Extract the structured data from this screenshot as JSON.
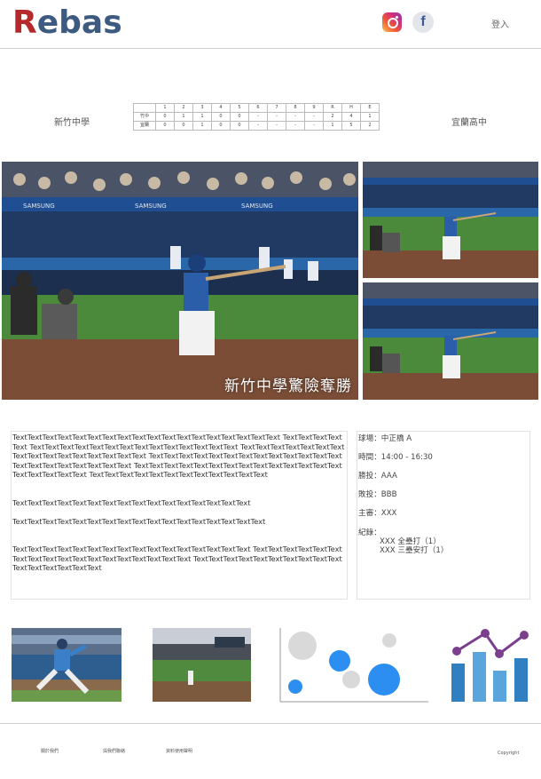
{
  "header": {
    "logo_first": "R",
    "logo_rest": "ebas",
    "login_label": "登入",
    "icons": [
      "instagram-icon",
      "facebook-icon"
    ],
    "facebook_glyph": "f"
  },
  "scoreboard": {
    "home_team": "新竹中學",
    "away_team": "宜蘭高中",
    "header": [
      "",
      "1",
      "2",
      "3",
      "4",
      "5",
      "6",
      "7",
      "8",
      "9",
      "R",
      "H",
      "E"
    ],
    "rows": [
      [
        "竹中",
        "0",
        "1",
        "1",
        "0",
        "0",
        "-",
        "-",
        "-",
        "-",
        "2",
        "4",
        "1"
      ],
      [
        "宜蘭",
        "0",
        "0",
        "1",
        "0",
        "0",
        "-",
        "-",
        "-",
        "-",
        "1",
        "5",
        "2"
      ]
    ]
  },
  "hero": {
    "caption": "新竹中學驚險奪勝",
    "banner_text": "SAMSUNG"
  },
  "article": {
    "paragraphs": [
      "TextTextTextTextTextTextTextTextTextTextTextTextTextTextTextTextTextText TextTextTextTextText TextTextTextTextTextTextTextTextTextTextTextTextTextText TextTextTextTextTextTextTextTextTextTextTextTextTextTextTextText TextTextTextTextTextTextTextTextTextTextTextTextTextTextTextTextTextTextTextTextText TextTextTextTextTextTextTextTextTextTextTextTextTextTextTextTextTextTextText TextTextTextTextTextTextTextTextTextTextTextText",
      "TextTextTextTextTextTextTextTextTextTextTextTextTextTextTextText",
      "TextTextTextTextTextTextTextTextTextTextTextTextTextTextTextTextText",
      "TextTextTextTextTextTextTextTextTextTextTextTextTextTextTextText TextTextTextTextTextTextTextTextTextTextTextTextTextTextTextTextTextText TextTextTextTextTextTextTextTextTextTextTextTextTextTextTextText"
    ]
  },
  "game_info": {
    "venue": "球場：中正橋 A",
    "time": "時間：14:00 - 16:30",
    "winning_pitcher": "勝投：AAA",
    "losing_pitcher": "敗投：BBB",
    "umpire": "主審：XXX",
    "records_label": "紀錄：",
    "records": [
      "XXX 全壘打（1）",
      "XXX 三壘安打（1）"
    ]
  },
  "footer": {
    "links": [
      "關於我們",
      "與我們聯絡",
      "資料使用聲明"
    ],
    "copyright": "Copyright"
  },
  "colors": {
    "logo_red": "#b5292c",
    "logo_blue": "#3d5a80",
    "bubble_blue": "#2b8ef0",
    "bubble_grey": "#d9d9d9",
    "bar_blue": "#2f7fc1",
    "line_purple": "#7b3f8e"
  }
}
